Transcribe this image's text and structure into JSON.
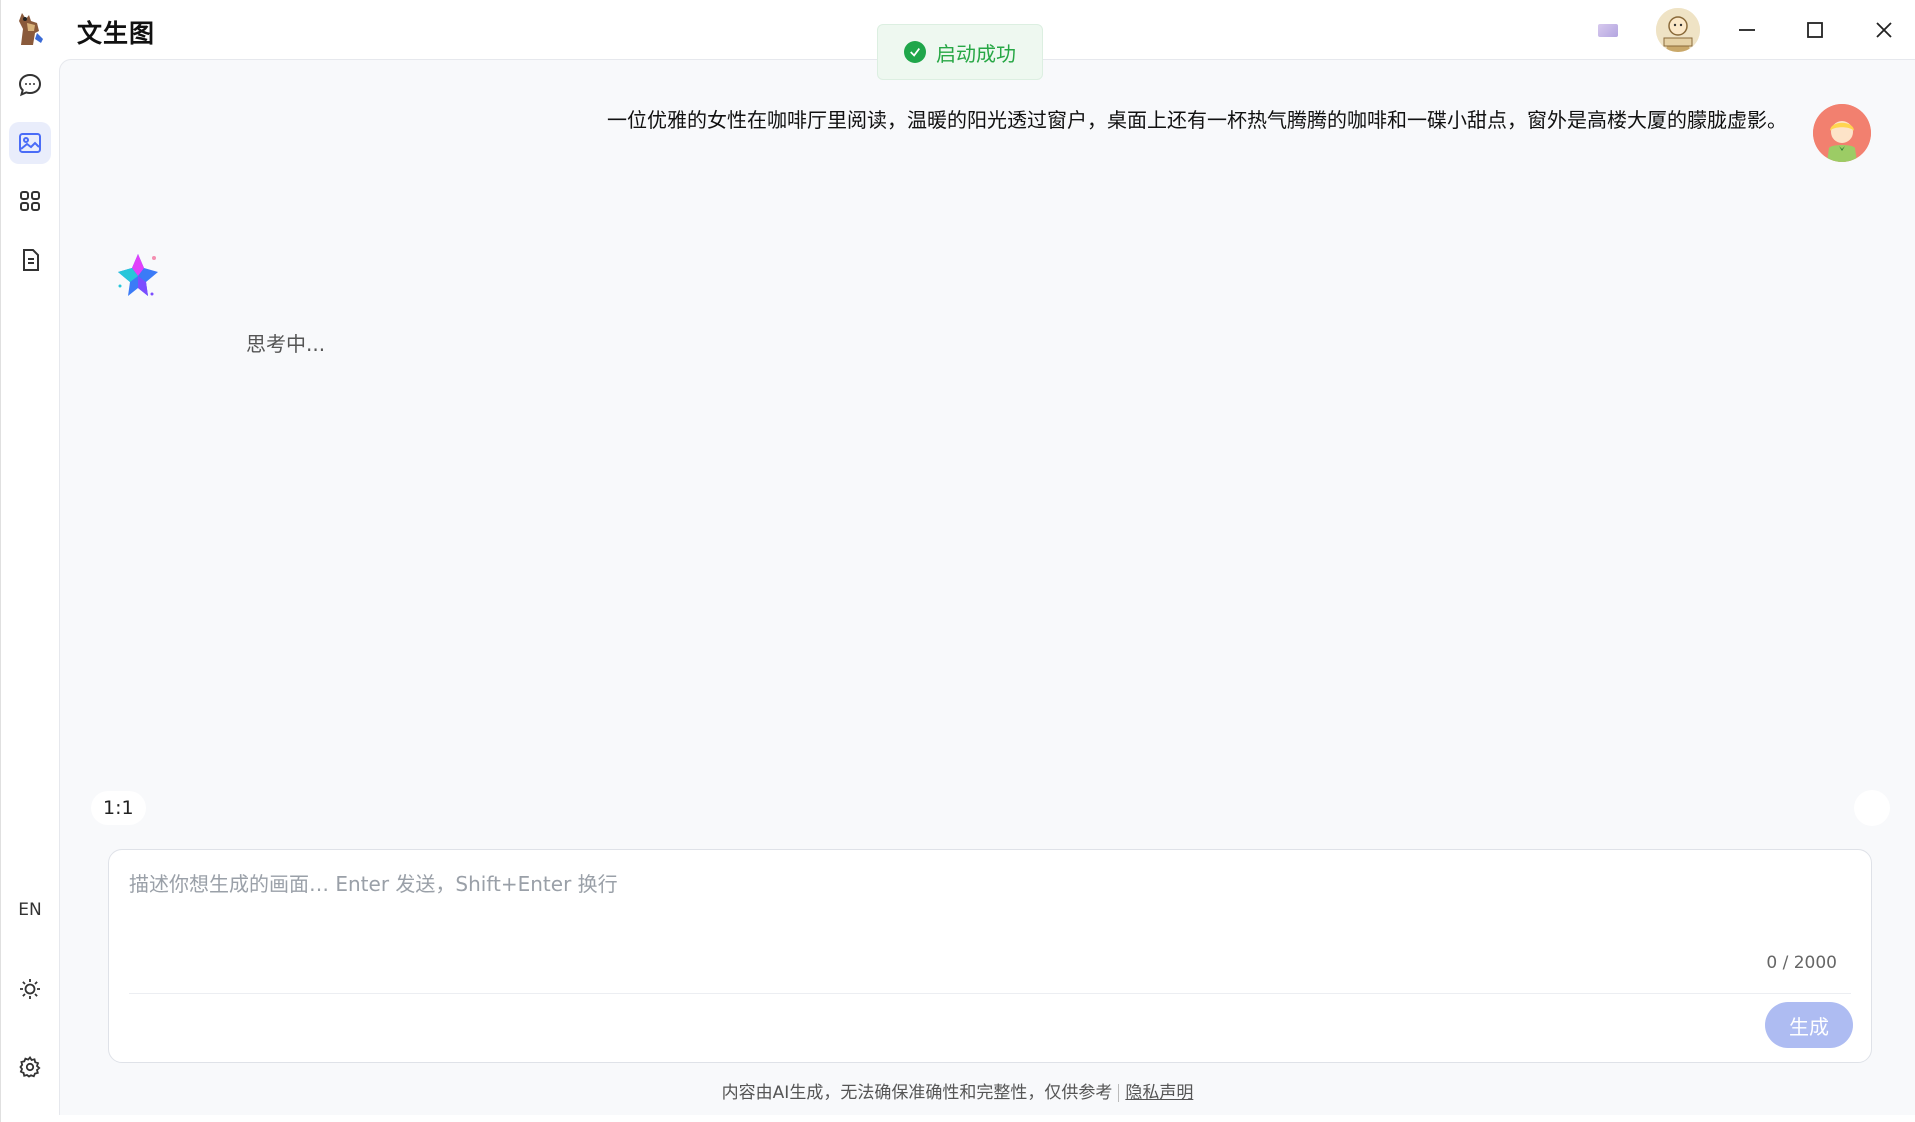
{
  "window": {
    "title": "文生图"
  },
  "toast": {
    "message": "启动成功",
    "color": "#27a745"
  },
  "sidebar": {
    "items": [
      {
        "icon": "chat-bubble-icon",
        "active": false
      },
      {
        "icon": "image-icon",
        "active": true
      },
      {
        "icon": "apps-grid-icon",
        "active": false
      },
      {
        "icon": "document-icon",
        "active": false
      }
    ],
    "language_label": "EN",
    "bottom": [
      {
        "icon": "sun-icon"
      },
      {
        "icon": "gear-icon"
      }
    ]
  },
  "conversation": {
    "user_message": "一位优雅的女性在咖啡厅里阅读，温暖的阳光透过窗户，桌面上还有一杯热气腾腾的咖啡和一碟小甜点，窗外是高楼大厦的朦胧虚影。",
    "bot_status": "思考中..."
  },
  "composer": {
    "ratio": "1:1",
    "placeholder": "描述你想生成的画面… Enter 发送，Shift+Enter 换行",
    "value": "",
    "counter": "0 / 2000",
    "generate_label": "生成",
    "button_color": "#aebcf2"
  },
  "footer": {
    "disclaimer": "内容由AI生成，无法确保准确性和完整性，仅供参考",
    "privacy_link": "隐私声明"
  },
  "colors": {
    "accent": "#4a6cf7",
    "active_nav_bg": "#e9edfb",
    "panel_bg": "#f8f9fb"
  }
}
